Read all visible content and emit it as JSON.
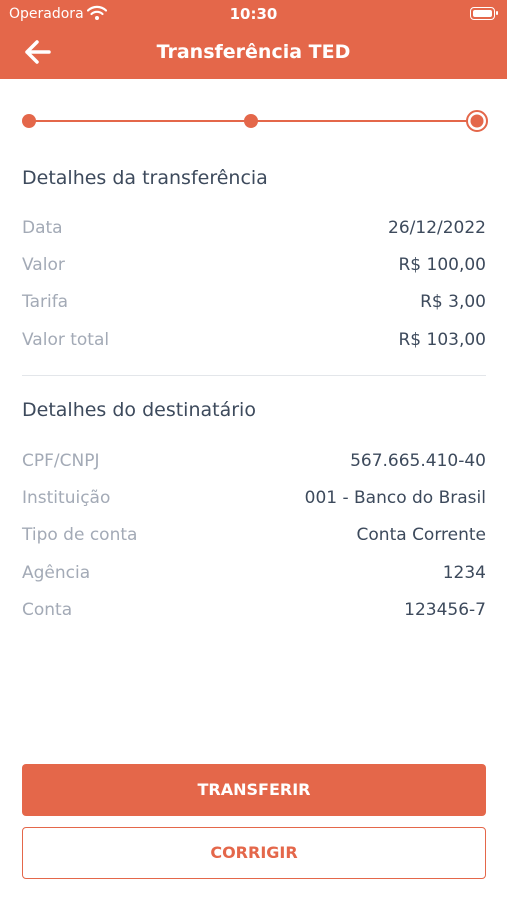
{
  "status_bar": {
    "carrier": "Operadora",
    "time": "10:30"
  },
  "header": {
    "title": "Transferência TED"
  },
  "stepper": {
    "steps": 3,
    "current_step": 3
  },
  "transfer_details": {
    "title": "Detalhes da transferência",
    "rows": [
      {
        "label": "Data",
        "value": "26/12/2022"
      },
      {
        "label": "Valor",
        "value": "R$ 100,00"
      },
      {
        "label": "Tarifa",
        "value": "R$ 3,00"
      },
      {
        "label": "Valor total",
        "value": "R$ 103,00"
      }
    ]
  },
  "recipient_details": {
    "title": "Detalhes do destinatário",
    "rows": [
      {
        "label": "CPF/CNPJ",
        "value": "567.665.410-40"
      },
      {
        "label": "Instituição",
        "value": "001 - Banco do Brasil"
      },
      {
        "label": "Tipo de conta",
        "value": "Conta Corrente"
      },
      {
        "label": "Agência",
        "value": "1234"
      },
      {
        "label": "Conta",
        "value": "123456-7"
      }
    ]
  },
  "actions": {
    "transfer_label": "TRANSFERIR",
    "correct_label": "CORRIGIR"
  },
  "colors": {
    "accent": "#e4674a",
    "text_primary": "#3d4a5c",
    "text_muted": "#a3aab6"
  },
  "icons": {
    "back": "arrow-left-icon",
    "wifi": "wifi-icon",
    "battery": "battery-icon"
  }
}
